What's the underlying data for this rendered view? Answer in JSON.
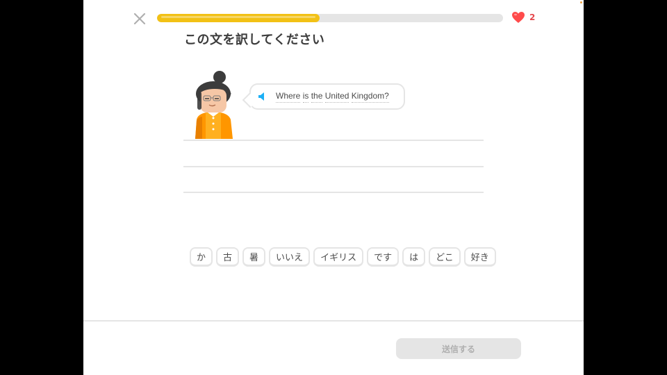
{
  "header": {
    "progress_percent": 47,
    "hearts_count": "2",
    "colors": {
      "progress": "#f2c115",
      "heart": "#e5484d"
    }
  },
  "title": "この文を訳してください",
  "prompt": {
    "words": [
      "Where",
      "is",
      "the",
      "United",
      "Kingdom?"
    ]
  },
  "word_bank": [
    "か",
    "古",
    "暑",
    "いいえ",
    "イギリス",
    "です",
    "は",
    "どこ",
    "好き"
  ],
  "footer": {
    "submit_label": "送信する"
  }
}
